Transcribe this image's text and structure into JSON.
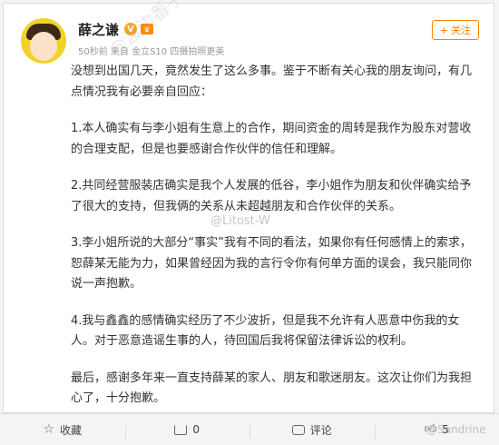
{
  "user": {
    "name": "薛之谦",
    "badge": "V",
    "vip": "♛",
    "meta": "50秒前 来自 金立S10 四摄拍照更美",
    "follow_label": "关注"
  },
  "post": {
    "paragraphs": [
      "没想到出国几天，竟然发生了这么多事。鉴于不断有关心我的朋友询问，有几点情况我有必要亲自回应：",
      "1.本人确实有与李小姐有生意上的合作，期间资金的周转是我作为股东对营收的合理支配，但是也要感谢合作伙伴的信任和理解。",
      "2.共同经营服装店确实是我个人发展的低谷，李小姐作为朋友和伙伴确实给予了很大的支持，但我俩的关系从未超越朋友和合作伙伴的关系。",
      "3.李小姐所说的大部分“事实”我有不同的看法，如果你有任何感情上的索求，恕薛某无能为力，如果曾经因为我的言行令你有何单方面的误会，我只能同你说一声抱歉。",
      "4.我与鑫鑫的感情确实经历了不少波折，但是我不允许有人恶意中伤我的女人。对于恶意造谣生事的人，待回国后我将保留法律诉讼的权利。",
      "最后，感谢多年来一直支持薛某的家人、朋友和歌迷朋友。这次让你们为我担心了，十分抱歉。"
    ]
  },
  "footer": {
    "favorite_label": "收藏",
    "share_label": "0",
    "comment_label": "评论",
    "like_label": "5"
  },
  "watermarks": [
    "@渡边番子",
    "@Litost-W",
    "@Sandrine"
  ],
  "colors": {
    "accent": "#ff8200",
    "badge": "#f5a623",
    "text": "#333333"
  },
  "icons": [
    "star-icon",
    "share-icon",
    "comment-icon",
    "thumbs-up-icon",
    "verified-badge-icon",
    "vip-crown-icon",
    "plus-icon"
  ]
}
